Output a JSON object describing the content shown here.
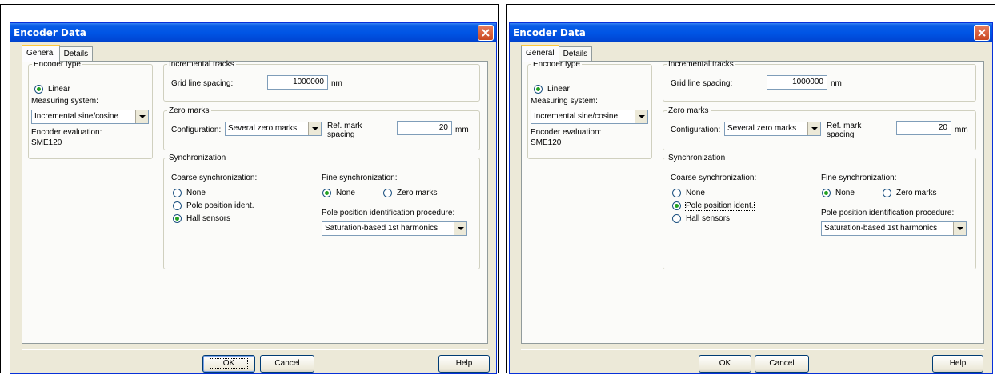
{
  "dialogs": [
    {
      "title": "Encoder Data",
      "tabs": [
        "General",
        "Details"
      ],
      "encoder_type": {
        "legend": "Encoder type",
        "linear_label": "Linear",
        "measuring_system_label": "Measuring system:",
        "measuring_system_value": "Incremental sine/cosine",
        "evaluation_label": "Encoder evaluation:",
        "evaluation_value": "SME120"
      },
      "incremental_tracks": {
        "legend": "Incremental tracks",
        "grid_label": "Grid line spacing:",
        "grid_value": "1000000",
        "grid_unit": "nm"
      },
      "zero_marks": {
        "legend": "Zero marks",
        "config_label": "Configuration:",
        "config_value": "Several zero marks",
        "ref_label_1": "Ref. mark",
        "ref_label_2": "spacing",
        "ref_value": "20",
        "ref_unit": "mm"
      },
      "synchronization": {
        "legend": "Synchronization",
        "coarse_label": "Coarse synchronization:",
        "coarse_options": [
          "None",
          "Pole position ident.",
          "Hall sensors"
        ],
        "coarse_selected": 2,
        "fine_label": "Fine synchronization:",
        "fine_options": [
          "None",
          "Zero marks"
        ],
        "fine_selected": 0,
        "procedure_label": "Pole position identification procedure:",
        "procedure_value": "Saturation-based 1st harmonics"
      },
      "buttons": {
        "ok": "OK",
        "cancel": "Cancel",
        "help": "Help"
      }
    },
    {
      "title": "Encoder Data",
      "tabs": [
        "General",
        "Details"
      ],
      "encoder_type": {
        "legend": "Encoder type",
        "linear_label": "Linear",
        "measuring_system_label": "Measuring system:",
        "measuring_system_value": "Incremental sine/cosine",
        "evaluation_label": "Encoder evaluation:",
        "evaluation_value": "SME120"
      },
      "incremental_tracks": {
        "legend": "Incremental tracks",
        "grid_label": "Grid line spacing:",
        "grid_value": "1000000",
        "grid_unit": "nm"
      },
      "zero_marks": {
        "legend": "Zero marks",
        "config_label": "Configuration:",
        "config_value": "Several zero marks",
        "ref_label_1": "Ref. mark",
        "ref_label_2": "spacing",
        "ref_value": "20",
        "ref_unit": "mm"
      },
      "synchronization": {
        "legend": "Synchronization",
        "coarse_label": "Coarse synchronization:",
        "coarse_options": [
          "None",
          "Pole position ident.",
          "Hall sensors"
        ],
        "coarse_selected": 1,
        "fine_label": "Fine synchronization:",
        "fine_options": [
          "None",
          "Zero marks"
        ],
        "fine_selected": 0,
        "procedure_label": "Pole position identification procedure:",
        "procedure_value": "Saturation-based 1st harmonics"
      },
      "buttons": {
        "ok": "OK",
        "cancel": "Cancel",
        "help": "Help"
      }
    }
  ],
  "colors": {
    "titlebar": "#0055e5",
    "dialog_face": "#ece9d8",
    "radio_selected": "#21a121",
    "close_button": "#c94720"
  },
  "icons": {
    "close": "close-x-icon",
    "dropdown": "chevron-down-icon"
  }
}
